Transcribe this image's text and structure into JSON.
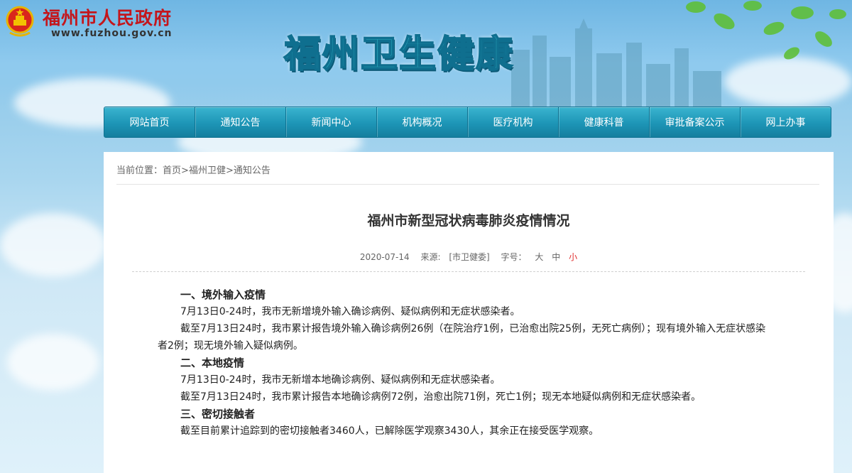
{
  "header": {
    "site_name": "福州市人民政府",
    "site_url": "www.fuzhou.gov.cn",
    "banner_title": "福州卫生健康"
  },
  "nav": {
    "items": [
      "网站首页",
      "通知公告",
      "新闻中心",
      "机构概况",
      "医疗机构",
      "健康科普",
      "审批备案公示",
      "网上办事"
    ]
  },
  "breadcrumb": {
    "prefix": "当前位置：",
    "home": "首页",
    "section": "福州卫健",
    "current": "通知公告",
    "separator": ">"
  },
  "article": {
    "title": "福州市新型冠状病毒肺炎疫情情况",
    "date": "2020-07-14",
    "source_label": "来源:",
    "source": "[市卫健委]",
    "font_size_label": "字号：",
    "font_large": "大",
    "font_medium": "中",
    "font_small": "小",
    "paragraphs": [
      {
        "type": "heading",
        "text": "一、境外输入疫情"
      },
      {
        "type": "text",
        "text": "7月13日0-24时，我市无新增境外输入确诊病例、疑似病例和无症状感染者。"
      },
      {
        "type": "text",
        "text": "截至7月13日24时，我市累计报告境外输入确诊病例26例（在院治疗1例，已治愈出院25例，无死亡病例）；现有境外输入无症状感染者2例；现无境外输入疑似病例。"
      },
      {
        "type": "heading",
        "text": "二、本地疫情"
      },
      {
        "type": "text",
        "text": "7月13日0-24时，我市无新增本地确诊病例、疑似病例和无症状感染者。"
      },
      {
        "type": "text",
        "text": "截至7月13日24时，我市累计报告本地确诊病例72例，治愈出院71例，死亡1例；现无本地疑似病例和无症状感染者。"
      },
      {
        "type": "heading",
        "text": "三、密切接触者"
      },
      {
        "type": "text",
        "text": "截至目前累计追踪到的密切接触者3460人，已解除医学观察3430人，其余正在接受医学观察。"
      }
    ]
  },
  "colors": {
    "nav_bg": "#1d95b6",
    "site_name": "#c4161c",
    "banner_title": "#35c3d0",
    "font_small_active": "#e03030"
  },
  "icons": [
    "national-emblem-icon",
    "city-skyline-illustration",
    "leaves-decoration"
  ]
}
